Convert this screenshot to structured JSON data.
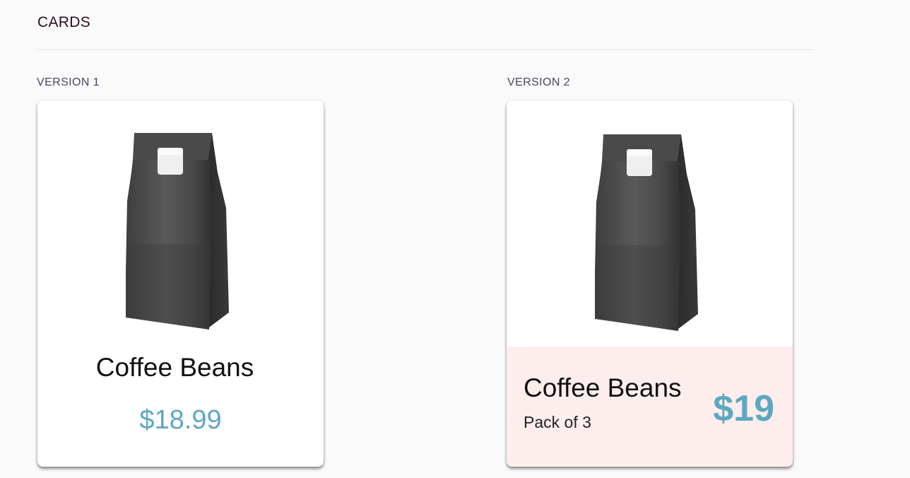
{
  "header": {
    "title": "CARDS"
  },
  "versions": [
    {
      "label": "VERSION 1",
      "card": {
        "image_icon": "coffee-bag-icon",
        "title": "Coffee Beans",
        "price": "$18.99"
      }
    },
    {
      "label": "VERSION 2",
      "card": {
        "image_icon": "coffee-bag-icon",
        "title": "Coffee Beans",
        "subtitle": "Pack of 3",
        "price": "$19",
        "footer_color": "#fdeeed"
      }
    }
  ],
  "colors": {
    "accent_price": "#5fa8c0",
    "background": "#fafafa",
    "card": "#ffffff"
  }
}
